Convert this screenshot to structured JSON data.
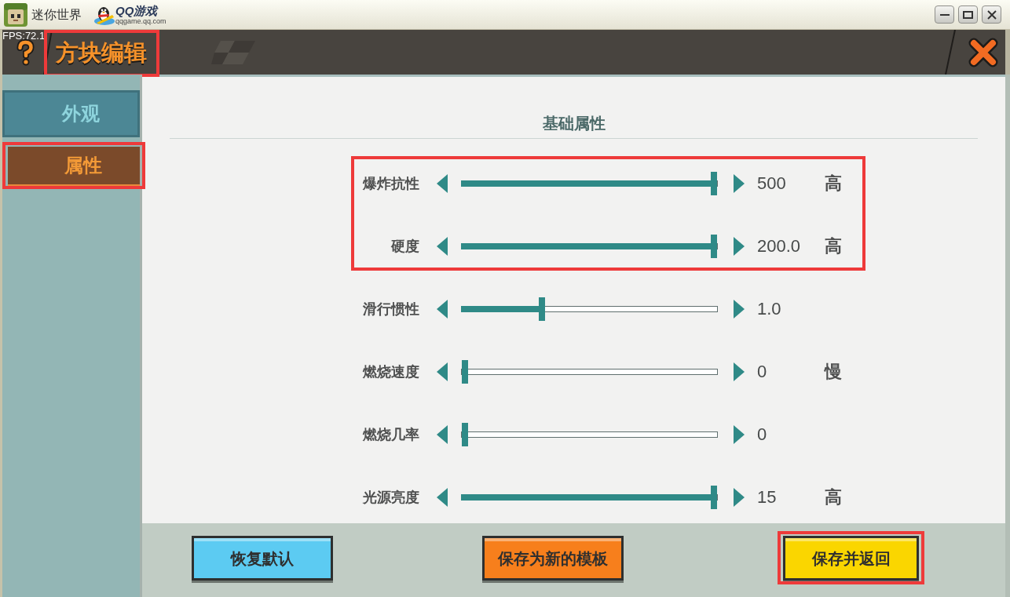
{
  "window": {
    "title": "迷你世界",
    "brand": "QQ游戏",
    "brand_url": "qqgame.qq.com"
  },
  "fps": "FPS:72.1",
  "header": {
    "title": "方块编辑",
    "highlighted": true
  },
  "tabs": [
    {
      "label": "外观",
      "selected": false,
      "highlighted": false
    },
    {
      "label": "属性",
      "selected": true,
      "highlighted": true
    }
  ],
  "section_title": "基础属性",
  "slider_groups": [
    {
      "highlighted": true,
      "sliders": [
        {
          "label": "爆炸抗性",
          "level": 1,
          "value": "500",
          "unit": "高"
        },
        {
          "label": "硬度",
          "level": 1,
          "value": "200.0",
          "unit": "高"
        }
      ]
    },
    {
      "sliders": [
        {
          "label": "滑行惯性",
          "level": 0.31,
          "value": "1.0"
        },
        {
          "label": "燃烧速度",
          "level": 0,
          "value": "0",
          "unit": "慢"
        },
        {
          "label": "燃烧几率",
          "level": 0,
          "value": "0"
        },
        {
          "label": "光源亮度",
          "level": 1,
          "value": "15",
          "unit": "高"
        }
      ]
    }
  ],
  "buttons": [
    {
      "label": "恢复默认",
      "color": "#5ccbf2",
      "highlighted": false
    },
    {
      "label": "保存为新的模板",
      "color": "#f77f1c",
      "highlighted": false
    },
    {
      "label": "保存并返回",
      "color": "#fad600",
      "highlighted": true
    }
  ]
}
